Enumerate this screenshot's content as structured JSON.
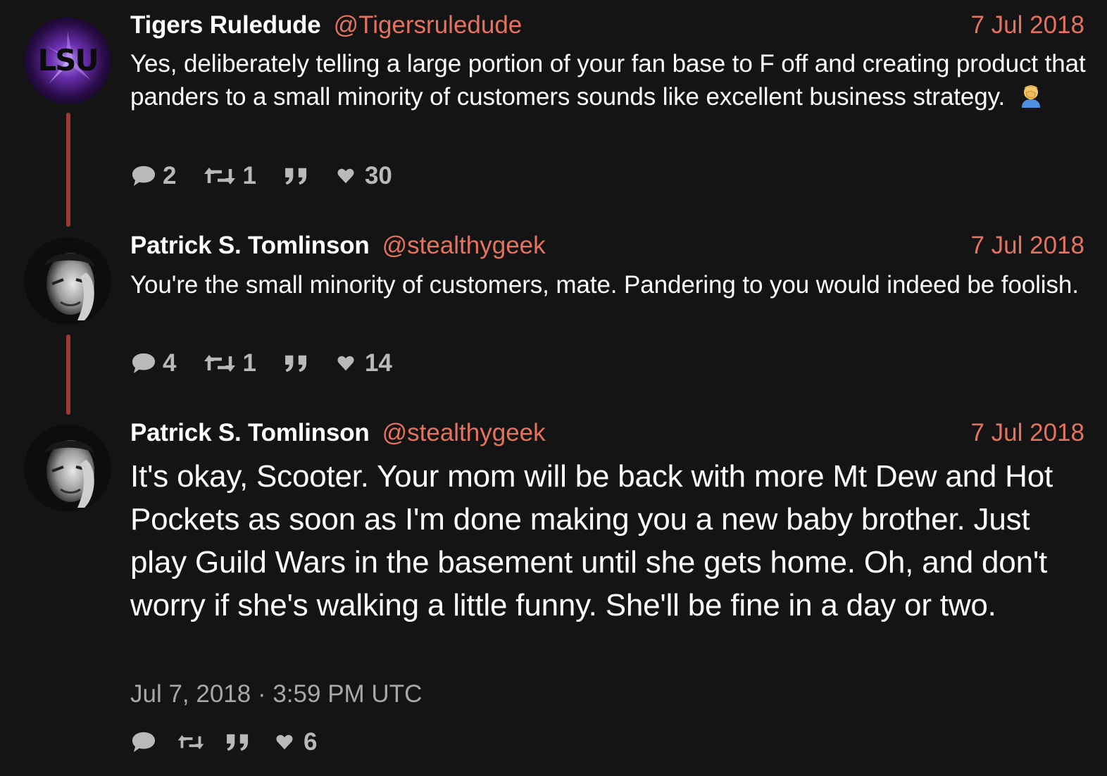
{
  "tweets": [
    {
      "fullname": "Tigers Ruledude",
      "username": "@Tigersruledude",
      "date": "7 Jul 2018",
      "text": "Yes, deliberately telling a large portion of your fan base to F off and creating product that panders to a small minority of customers sounds like excellent business strategy.",
      "emoji": "facepalm-emoji",
      "avatar": "lsu-logo-avatar",
      "stats": {
        "replies": "2",
        "retweets": "1",
        "quotes": "",
        "likes": "30"
      }
    },
    {
      "fullname": "Patrick S. Tomlinson",
      "username": "@stealthygeek",
      "date": "7 Jul 2018",
      "text": "You're the small minority of customers, mate. Pandering to you would indeed be foolish.",
      "avatar": "profile-photo-avatar",
      "stats": {
        "replies": "4",
        "retweets": "1",
        "quotes": "",
        "likes": "14"
      }
    },
    {
      "fullname": "Patrick S. Tomlinson",
      "username": "@stealthygeek",
      "date": "7 Jul 2018",
      "text": "It's okay, Scooter. Your mom will be back with more Mt Dew and Hot Pockets as soon as I'm done making you a new baby brother. Just play Guild Wars in the basement until she gets home. Oh, and don't worry if she's walking a little funny. She'll be fine in a day or two.",
      "published": "Jul 7, 2018 · 3:59 PM UTC",
      "avatar": "profile-photo-avatar",
      "stats": {
        "replies": "",
        "retweets": "",
        "quotes": "",
        "likes": "6"
      }
    }
  ],
  "colors": {
    "background": "#141414",
    "accent": "#e5725f",
    "thread_line": "#9b3b36",
    "stat_text": "#b9b9b9",
    "muted": "#a8a8a8"
  },
  "icons": [
    "comment-icon",
    "retweet-icon",
    "quote-icon",
    "heart-icon"
  ]
}
